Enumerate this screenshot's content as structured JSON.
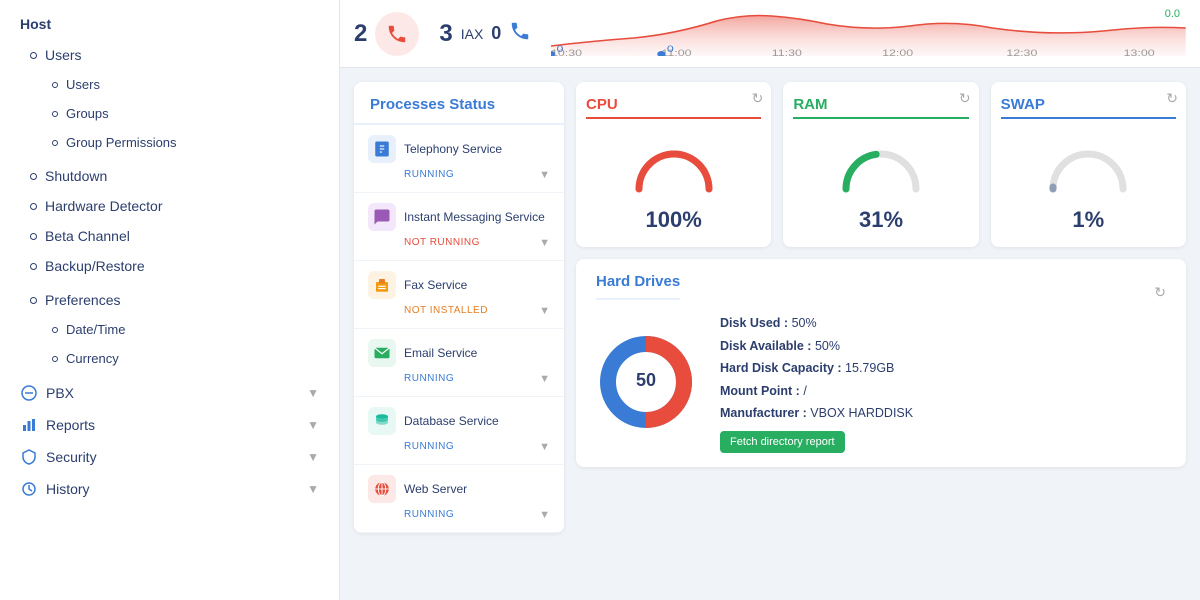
{
  "sidebar": {
    "host_label": "Host",
    "users_section": {
      "label": "Users",
      "items": [
        {
          "label": "Users"
        },
        {
          "label": "Groups"
        },
        {
          "label": "Group Permissions"
        }
      ]
    },
    "shutdown": {
      "label": "Shutdown"
    },
    "hardware_detector": {
      "label": "Hardware Detector"
    },
    "beta_channel": {
      "label": "Beta Channel"
    },
    "backup_restore": {
      "label": "Backup/Restore"
    },
    "preferences": {
      "label": "Preferences",
      "items": [
        {
          "label": "Date/Time"
        },
        {
          "label": "Currency"
        }
      ]
    },
    "pbx": {
      "label": "PBX"
    },
    "reports": {
      "label": "Reports"
    },
    "security": {
      "label": "Security"
    },
    "history": {
      "label": "History"
    }
  },
  "top": {
    "num1": "2",
    "num2": "3",
    "iax_label": "IAX",
    "iax_value": "0"
  },
  "graph": {
    "times": [
      "10:30",
      "11:00",
      "11:30",
      "12:00",
      "12:30",
      "13:00"
    ],
    "dots": [
      "0",
      "0"
    ],
    "value": "0.0"
  },
  "processes": {
    "title": "Processes Status",
    "items": [
      {
        "name": "Telephony Service",
        "status": "RUNNING",
        "status_class": "running",
        "icon_color": "#3a7bd5",
        "icon_char": "📋"
      },
      {
        "name": "Instant Messaging Service",
        "status": "NOT RUNNING",
        "status_class": "not-running",
        "icon_color": "#9b59b6",
        "icon_char": "💬"
      },
      {
        "name": "Fax Service",
        "status": "NOT INSTALLED",
        "status_class": "not-installed",
        "icon_color": "#f39c12",
        "icon_char": "🖨"
      },
      {
        "name": "Email Service",
        "status": "RUNNING",
        "status_class": "running",
        "icon_color": "#27ae60",
        "icon_char": "📧"
      },
      {
        "name": "Database Service",
        "status": "RUNNING",
        "status_class": "running",
        "icon_color": "#1abc9c",
        "icon_char": "🗄"
      },
      {
        "name": "Web Server",
        "status": "RUNNING",
        "status_class": "running",
        "icon_color": "#e74c3c",
        "icon_char": "🌐"
      }
    ]
  },
  "cpu": {
    "label": "CPU",
    "value": "100%",
    "percent": 100,
    "color": "#e74c3c"
  },
  "ram": {
    "label": "RAM",
    "value": "31%",
    "percent": 31,
    "color": "#27ae60"
  },
  "swap": {
    "label": "SWAP",
    "value": "1%",
    "percent": 1,
    "color": "#3a7bd5"
  },
  "hard_drives": {
    "title": "Hard Drives",
    "disk_used": "50%",
    "disk_available": "50%",
    "capacity": "15.79GB",
    "mount_point": "/",
    "manufacturer": "VBOX HARDDISK",
    "fetch_btn": "Fetch directory report",
    "percent": 50
  }
}
